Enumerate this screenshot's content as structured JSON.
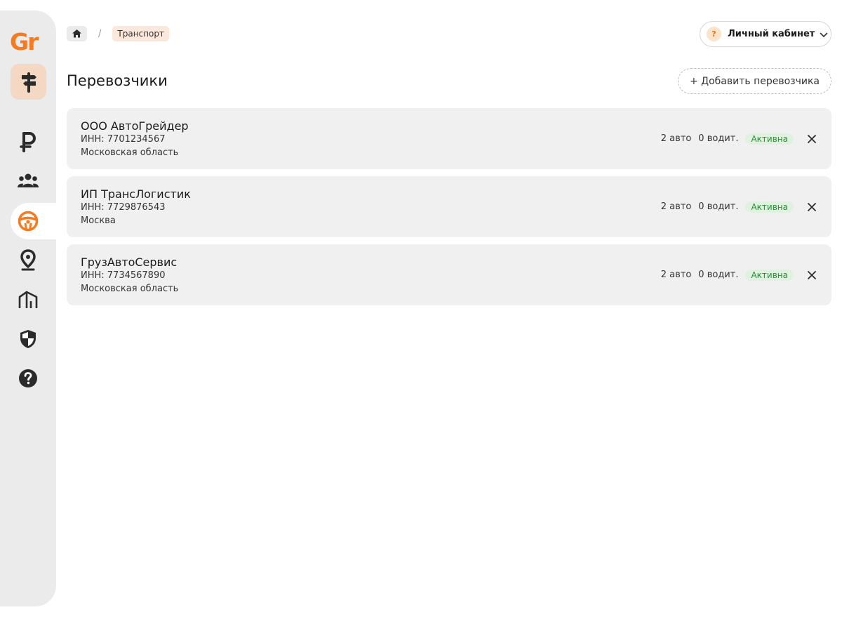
{
  "sidebar": {
    "logo": "Gr",
    "items": [
      {
        "name": "brand-signpost-icon"
      },
      {
        "name": "ruble-icon"
      },
      {
        "name": "users-icon"
      },
      {
        "name": "steering-wheel-icon"
      },
      {
        "name": "map-pin-icon"
      },
      {
        "name": "warehouse-icon"
      },
      {
        "name": "shield-icon"
      },
      {
        "name": "help-icon"
      }
    ],
    "accent_color": "#f47b20"
  },
  "breadcrumb": {
    "home_icon": "home-icon",
    "separator": "/",
    "current": "Транспорт"
  },
  "account": {
    "badge": "?",
    "label": "Личный кабинет",
    "chevron_icon": "chevron-down-icon"
  },
  "page": {
    "title": "Перевозчики",
    "add_button": "+ Добавить перевозчика"
  },
  "carriers": [
    {
      "name": "ООО АвтоГрейдер",
      "inn": "ИНН: 7701234567",
      "region": "Московская область",
      "vehicles": "2 авто",
      "drivers": "0 водит.",
      "status": "Активна"
    },
    {
      "name": "ИП ТрансЛогистик",
      "inn": "ИНН: 7729876543",
      "region": "Москва",
      "vehicles": "2 авто",
      "drivers": "0 водит.",
      "status": "Активна"
    },
    {
      "name": "ГрузАвтоСервис",
      "inn": "ИНН: 7734567890",
      "region": "Московская область",
      "vehicles": "2 авто",
      "drivers": "0 водит.",
      "status": "Активна"
    }
  ],
  "colors": {
    "status_active_bg": "#dff2e0",
    "status_active_text": "#2e8b3a",
    "breadcrumb_current_bg": "#fbe8dc"
  }
}
